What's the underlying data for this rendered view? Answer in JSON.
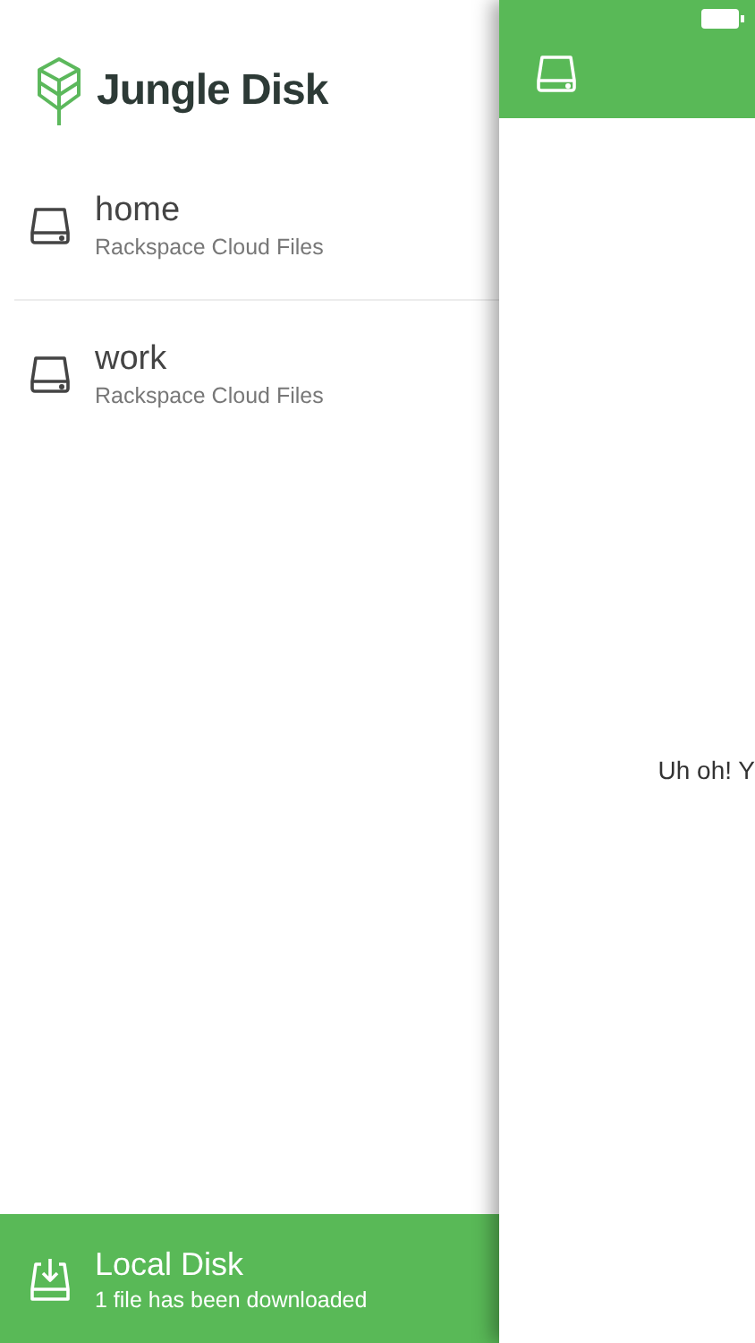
{
  "drawer": {
    "brand": "Jungle Disk",
    "items": [
      {
        "name": "home",
        "provider": "Rackspace Cloud Files"
      },
      {
        "name": "work",
        "provider": "Rackspace Cloud Files"
      }
    ],
    "local_disk": {
      "title": "Local Disk",
      "status": "1 file has been downloaded"
    }
  },
  "main": {
    "message": "Uh oh! Y"
  }
}
